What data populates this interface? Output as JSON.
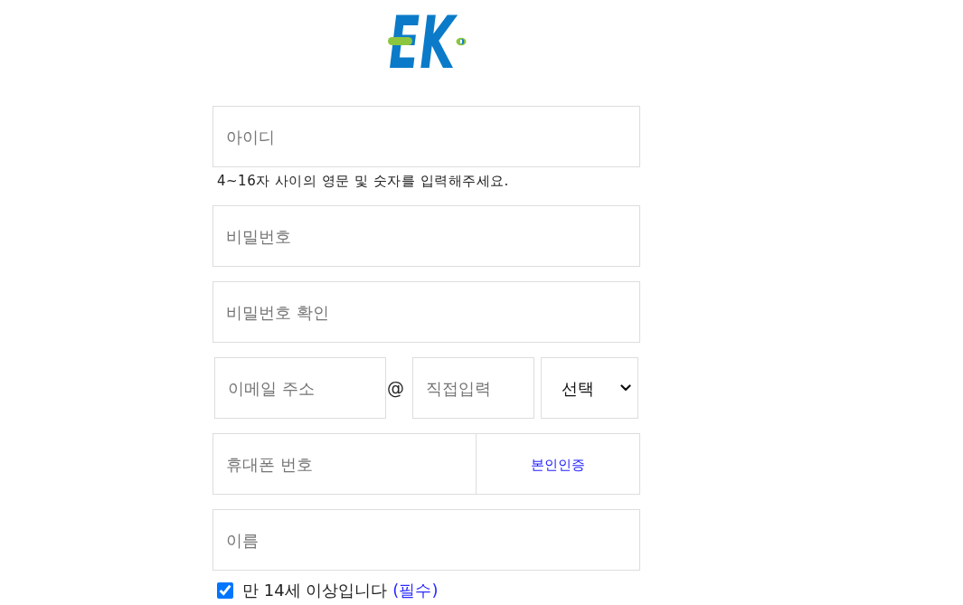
{
  "logo": {
    "text": "EK"
  },
  "form": {
    "rows": [
      {
        "kind": "input",
        "placeholder": "아이디",
        "hint": "4~16자 사이의 영문 및 숫자를 입력해주세요."
      },
      {
        "kind": "input",
        "placeholder": "비밀번호"
      },
      {
        "kind": "input",
        "placeholder": "비밀번호 확인"
      },
      {
        "kind": "email",
        "local_placeholder": "이메일 주소",
        "separator": "@",
        "domain_placeholder": "직접입력",
        "select_value": "선택"
      },
      {
        "kind": "phone",
        "placeholder": "휴대폰 번호",
        "button": "본인인증"
      },
      {
        "kind": "input",
        "placeholder": "이름"
      }
    ],
    "agreement": {
      "checked": true,
      "label": "만 14세 이상입니다",
      "required_mark": "(필수)"
    }
  }
}
